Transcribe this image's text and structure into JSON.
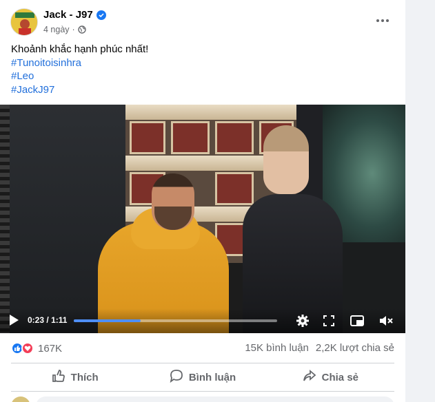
{
  "post": {
    "author": "Jack - J97",
    "time": "4 ngày",
    "privacy_icon": "globe-icon",
    "text": "Khoảnh khắc hạnh phúc nhất!",
    "hashtags": [
      "#Tunoitoisinhra",
      "#Leo",
      "#JackJ97"
    ]
  },
  "video": {
    "current_time": "0:23",
    "separator": "/",
    "duration": "1:11",
    "progress_fraction": 0.33
  },
  "stats": {
    "reaction_count": "167K",
    "comments": "15K bình luận",
    "shares": "2,2K lượt chia sẻ"
  },
  "actions": {
    "like": "Thích",
    "comment": "Bình luận",
    "share": "Chia sẻ"
  },
  "colors": {
    "link": "#216fdb",
    "like_blue": "#1877f2",
    "love_red": "#f33e58",
    "secondary_text": "#65676b"
  }
}
